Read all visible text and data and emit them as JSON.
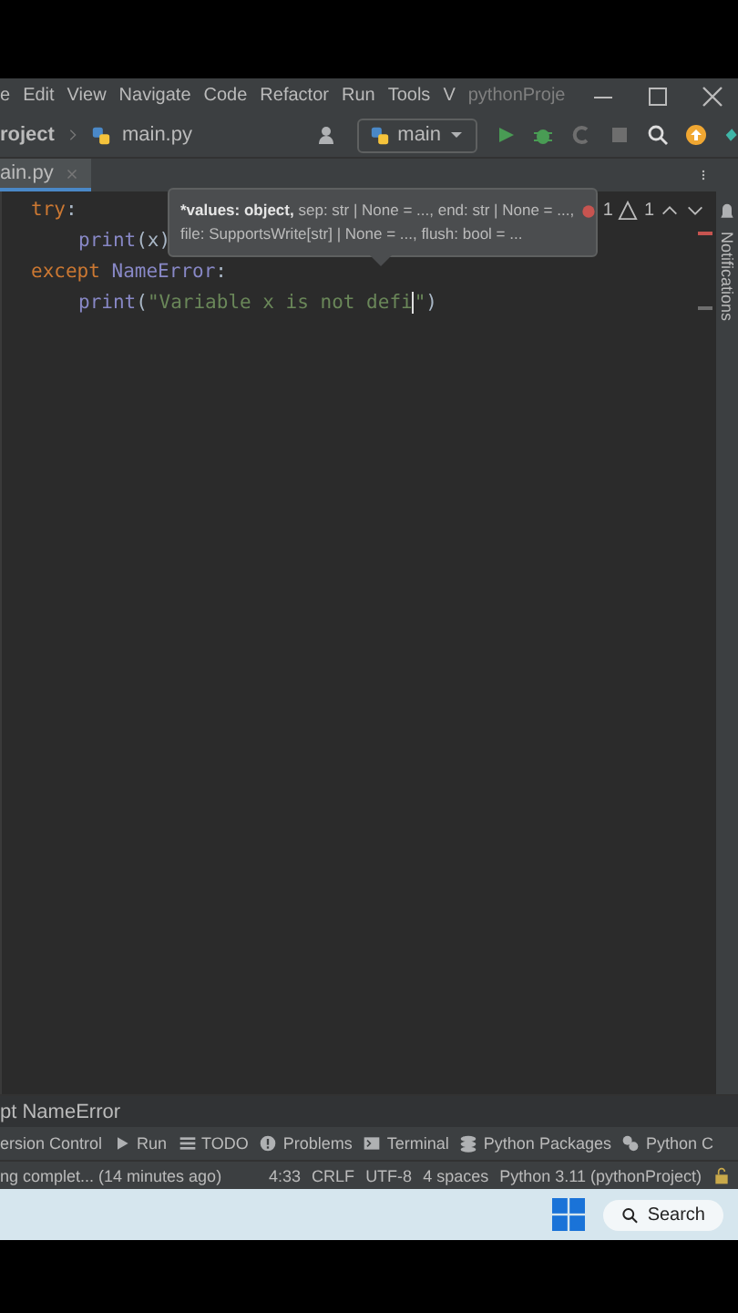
{
  "menu_bar": {
    "items": [
      "e",
      "Edit",
      "View",
      "Navigate",
      "Code",
      "Refactor",
      "Run",
      "Tools",
      "V"
    ],
    "window_title": "pythonProje"
  },
  "toolbar": {
    "breadcrumb": [
      "roject",
      "main.py"
    ],
    "run_configuration": "main"
  },
  "tabs": [
    {
      "label": "ain.py",
      "selected": true
    }
  ],
  "editor": {
    "lines": [
      {
        "indented": false,
        "tokens": [
          {
            "text": "try",
            "kind": "keyword",
            "caret_after": false
          },
          {
            "text": ":",
            "kind": "punct",
            "caret_after": false
          }
        ]
      },
      {
        "indented": true,
        "tokens": [
          {
            "text": "print",
            "kind": "builtin",
            "caret_after": false
          },
          {
            "text": "(x)",
            "kind": "punct",
            "caret_after": false
          }
        ]
      },
      {
        "indented": false,
        "tokens": [
          {
            "text": "except ",
            "kind": "keyword",
            "caret_after": false
          },
          {
            "text": "NameError",
            "kind": "builtin",
            "caret_after": false
          },
          {
            "text": ":",
            "kind": "punct",
            "caret_after": false
          }
        ]
      },
      {
        "indented": true,
        "tokens": [
          {
            "text": "print",
            "kind": "builtin",
            "caret_after": false
          },
          {
            "text": "(",
            "kind": "punct",
            "caret_after": false
          },
          {
            "text": "\"Variable x is not defi",
            "kind": "string",
            "caret_after": true
          },
          {
            "text": "\"",
            "kind": "string",
            "caret_after": false
          },
          {
            "text": ")",
            "kind": "punct",
            "caret_after": false
          }
        ]
      }
    ],
    "inspections": {
      "errors": "1",
      "warnings": "1"
    },
    "tooltip": {
      "parameter": "*values: object,",
      "rest": "sep: str | None = ..., end: str | None = ..., file: SupportsWrite[str] | None = ..., flush: bool = ..."
    }
  },
  "notifications_label": "Notifications",
  "breadcrumb": "pt NameError",
  "tool_windows": [
    "ersion Control",
    "Run",
    "TODO",
    "Problems",
    "Terminal",
    "Python Packages",
    "Python C"
  ],
  "status_bar": {
    "message": "ng complet... (14 minutes ago)",
    "items": [
      "4:33",
      "CRLF",
      "UTF-8",
      "4 spaces",
      "Python 3.11 (pythonProject)"
    ]
  },
  "taskbar": {
    "search": "Search"
  }
}
